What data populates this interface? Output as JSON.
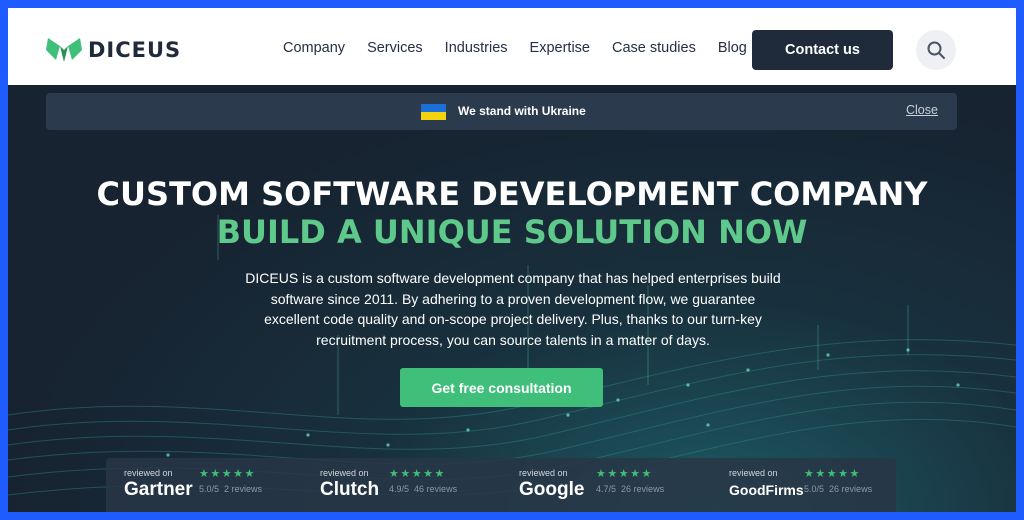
{
  "header": {
    "logo_text": "DICEUS",
    "nav": [
      "Company",
      "Services",
      "Industries",
      "Expertise",
      "Case studies",
      "Blog"
    ],
    "contact_label": "Contact us",
    "search_icon": "search-icon"
  },
  "banner": {
    "text": "We stand with Ukraine",
    "close_label": "Close"
  },
  "hero": {
    "title": "CUSTOM SOFTWARE DEVELOPMENT COMPANY",
    "subtitle": "BUILD A UNIQUE SOLUTION NOW",
    "description_lines": [
      "DICEUS is a custom software development company that has helped enterprises build",
      "software since 2011. By adhering to a proven development flow, we guarantee",
      "excellent code quality and on-scope project delivery. Plus, thanks to our turn-key",
      "recruitment process, you can source talents in a matter of days."
    ],
    "cta_label": "Get free consultation"
  },
  "reviews": [
    {
      "label": "reviewed on",
      "brand": "Gartner",
      "stars": "★★★★★",
      "score": "5.0/5",
      "count": "2 reviews"
    },
    {
      "label": "reviewed on",
      "brand": "Clutch",
      "stars": "★★★★★",
      "score": "4.9/5",
      "count": "46 reviews"
    },
    {
      "label": "reviewed on",
      "brand": "Google",
      "stars": "★★★★★",
      "score": "4.7/5",
      "count": "26 reviews"
    },
    {
      "label": "reviewed on",
      "brand": "GoodFirms",
      "stars": "★★★★★",
      "score": "5.0/5",
      "count": "26 reviews"
    }
  ],
  "colors": {
    "brand_green": "#3fbf7a",
    "headline_green": "#5ec98a",
    "dark": "#1f2a3a"
  }
}
